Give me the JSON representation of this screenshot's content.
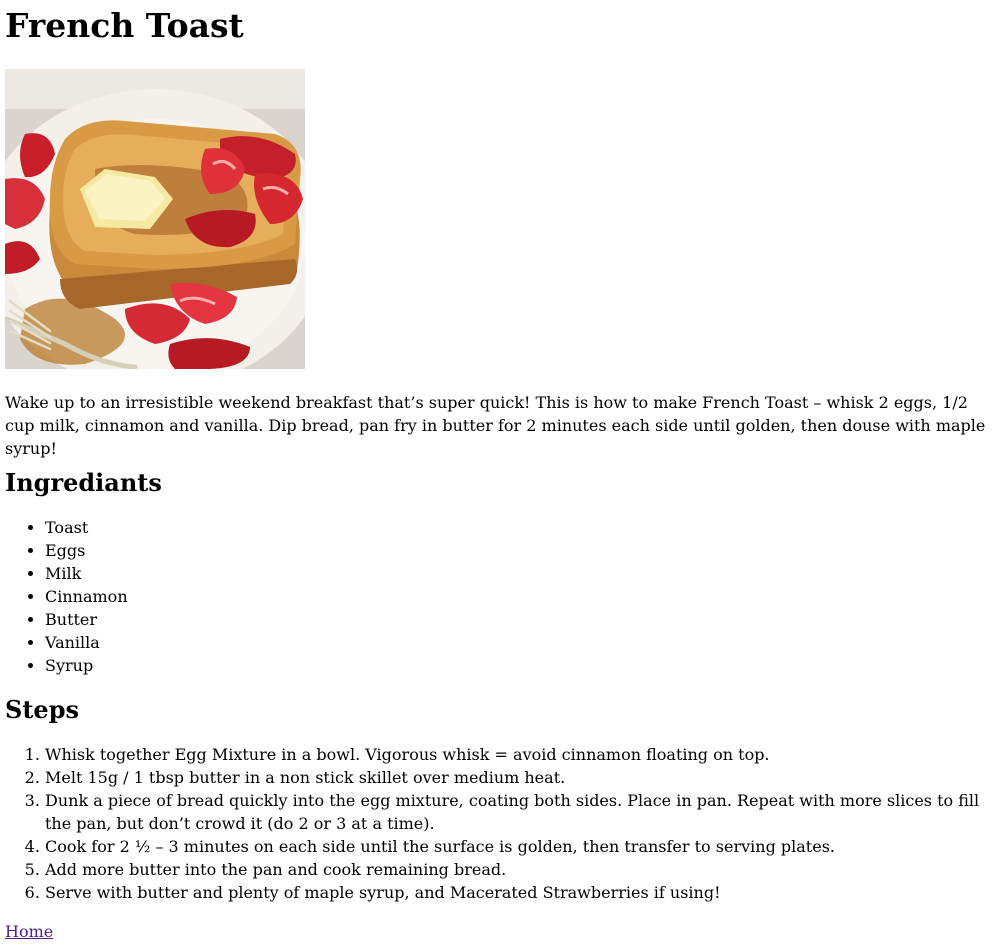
{
  "title": "French Toast",
  "image": {
    "alt": "French toast with butter, strawberries and maple syrup"
  },
  "intro": "Wake up to an irresistible weekend breakfast that’s super quick! This is how to make French Toast – whisk 2 eggs, 1/2 cup milk, cinnamon and vanilla. Dip bread, pan fry in butter for 2 minutes each side until golden, then douse with maple syrup!",
  "ingredients": {
    "heading": "Ingrediants",
    "items": [
      "Toast",
      "Eggs",
      "Milk",
      "Cinnamon",
      "Butter",
      "Vanilla",
      "Syrup"
    ]
  },
  "steps": {
    "heading": "Steps",
    "items": [
      "Whisk together Egg Mixture in a bowl. Vigorous whisk = avoid cinnamon floating on top.",
      "Melt 15g / 1 tbsp butter in a non stick skillet over medium heat.",
      "Dunk a piece of bread quickly into the egg mixture, coating both sides. Place in pan. Repeat with more slices to fill the pan, but don’t crowd it (do 2 or 3 at a time).",
      "Cook for 2 ½ – 3 minutes on each side until the surface is golden, then transfer to serving plates.",
      "Add more butter into the pan and cook remaining bread.",
      "Serve with butter and plenty of maple syrup, and Macerated Strawberries if using!"
    ]
  },
  "home_link": "Home"
}
